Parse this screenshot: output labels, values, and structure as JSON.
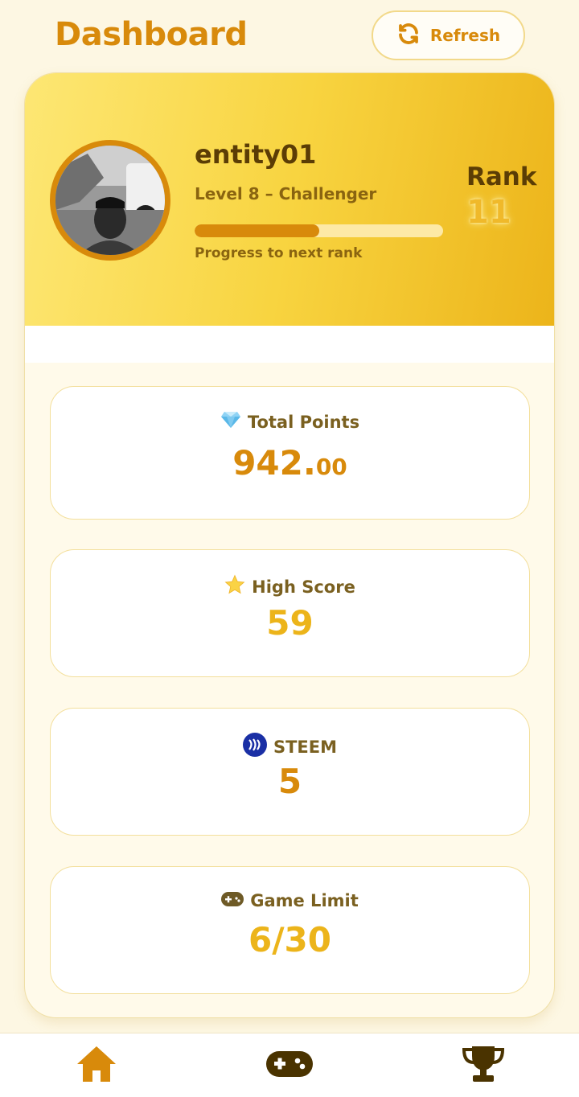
{
  "header": {
    "title": "Dashboard",
    "refresh_label": "Refresh"
  },
  "profile": {
    "username": "entity01",
    "level": "Level 8 – Challenger",
    "progress_label": "Progress to next rank",
    "progress_fraction": 0.5,
    "rank_label": "Rank",
    "rank_value": "11"
  },
  "stats": [
    {
      "label": "Total Points",
      "value_main": "942.",
      "value_decimal": "00",
      "icon": "gem-icon",
      "color": "#d88a0b"
    },
    {
      "label": "High Score",
      "value": "59",
      "icon": "star-icon",
      "color": "#ecb41a"
    },
    {
      "label": "STEEM",
      "value": "5",
      "icon": "steem-icon",
      "color": "#d88a0b"
    },
    {
      "label": "Game Limit",
      "value": "6/30",
      "icon": "gamepad-icon",
      "color": "#ecb41a"
    }
  ],
  "nav": {
    "items": [
      "home-icon",
      "gamepad-icon",
      "trophy-icon"
    ],
    "active_color": "#d88a0b",
    "inactive_color": "#4a3300"
  }
}
